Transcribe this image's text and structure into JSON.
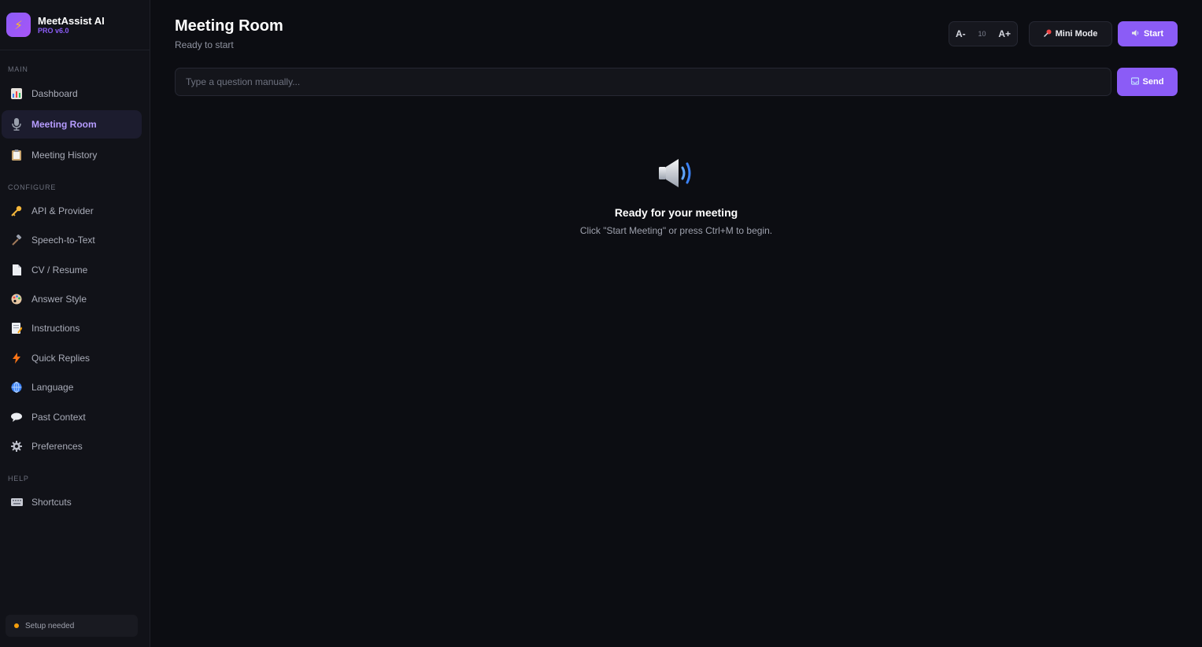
{
  "brand": {
    "name": "MeetAssist AI",
    "version": "PRO v6.0"
  },
  "sidebar": {
    "sections": {
      "main": "MAIN",
      "configure": "CONFIGURE",
      "help": "HELP"
    },
    "items": [
      {
        "label": "Dashboard",
        "icon": "chart-icon"
      },
      {
        "label": "Meeting Room",
        "icon": "microphone-icon"
      },
      {
        "label": "Meeting History",
        "icon": "clipboard-icon"
      },
      {
        "label": "API & Provider",
        "icon": "key-icon"
      },
      {
        "label": "Speech-to-Text",
        "icon": "hammer-icon"
      },
      {
        "label": "CV / Resume",
        "icon": "document-icon"
      },
      {
        "label": "Answer Style",
        "icon": "palette-icon"
      },
      {
        "label": "Instructions",
        "icon": "memo-icon"
      },
      {
        "label": "Quick Replies",
        "icon": "lightning-icon"
      },
      {
        "label": "Language",
        "icon": "globe-icon"
      },
      {
        "label": "Past Context",
        "icon": "speech-bubble-icon"
      },
      {
        "label": "Preferences",
        "icon": "gear-icon"
      },
      {
        "label": "Shortcuts",
        "icon": "keyboard-icon"
      }
    ],
    "status": {
      "text": "Setup needed",
      "color": "#f59e0b"
    }
  },
  "header": {
    "title": "Meeting Room",
    "subtitle": "Ready to start",
    "font_decrease": "A-",
    "font_size": "10",
    "font_increase": "A+",
    "mini_mode_label": "Mini Mode",
    "start_label": "Start"
  },
  "question": {
    "placeholder": "Type a question manually...",
    "value": "",
    "send_label": "Send"
  },
  "empty_state": {
    "icon": "speaker-icon",
    "title": "Ready for your meeting",
    "subtitle": "Click \"Start Meeting\" or press Ctrl+M to begin."
  },
  "colors": {
    "accent": "#8b5cf6",
    "background": "#0c0d12",
    "sidebar": "#111218"
  }
}
